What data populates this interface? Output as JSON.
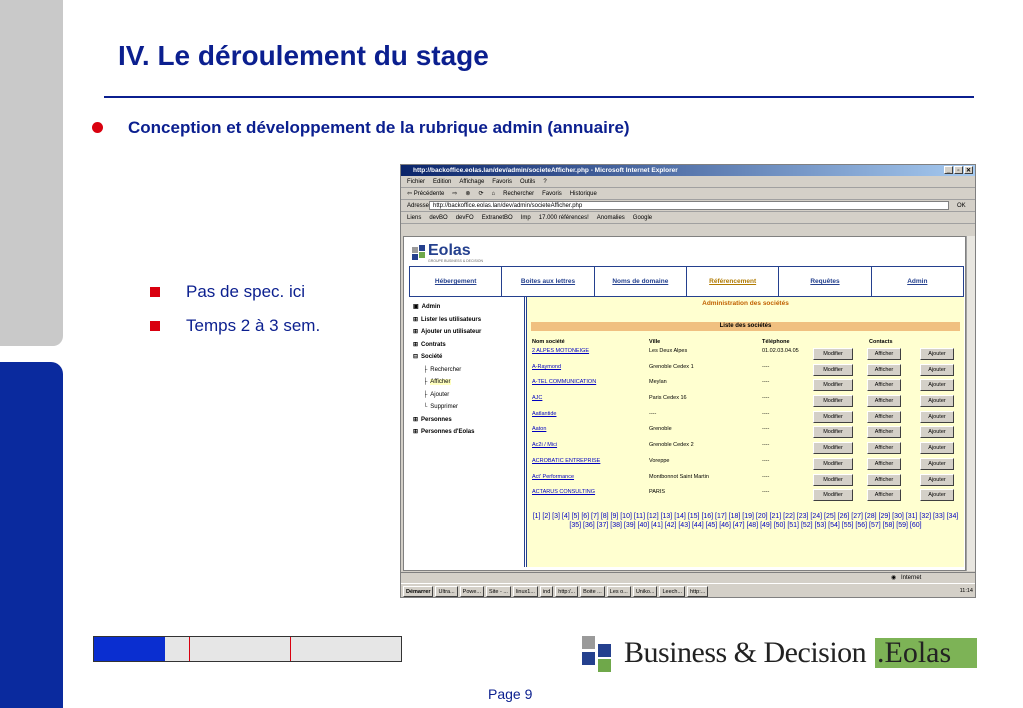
{
  "slide": {
    "title": "IV. Le déroulement du stage",
    "subtitle": "Conception et développement  de la rubrique admin (annuaire)",
    "bullets": [
      "Pas de spec. ici",
      "Temps  2 à 3 sem."
    ],
    "page": "Page 9",
    "footer_logo": {
      "main": "Business & Decision",
      "dot": ".",
      "brand": "Eolas"
    },
    "progress_fraction": 0.23,
    "colors": {
      "title": "#0b1f8f",
      "bullet": "#d9000f",
      "sidebar_top": "#c9c9c9",
      "sidebar_bottom": "#0a2a9e",
      "progress": "#0a2ed0"
    }
  },
  "browser": {
    "title": "http://backoffice.eolas.lan/dev/admin/societeAfficher.php - Microsoft Internet Explorer",
    "window_buttons": [
      "_",
      "▫",
      "✕"
    ],
    "menu": [
      "Fichier",
      "Edition",
      "Affichage",
      "Favoris",
      "Outils",
      "?"
    ],
    "toolbar": [
      "⇦ Précédente",
      "⇨",
      "⊗",
      "⟳",
      "⌂",
      "Rechercher",
      "Favoris",
      "Historique"
    ],
    "address_label": "Adresse",
    "address": "http://backoffice.eolas.lan/dev/admin/societeAfficher.php",
    "go": "OK",
    "links_label": "Liens",
    "links": [
      "devBO",
      "devFO",
      "ExtranetBO",
      "Imp",
      "17.000 références!",
      "Anomalies",
      "Google"
    ],
    "status_zone": "Internet",
    "status_icon": "globe-icon"
  },
  "site": {
    "logo": "Eolas",
    "logo_sub": "GROUPE BUSINESS & DECISION",
    "nav": [
      {
        "label": "Hébergement"
      },
      {
        "label": "Boites aux lettres"
      },
      {
        "label": "Noms de domaine"
      },
      {
        "label": "Référencement",
        "highlight": true
      },
      {
        "label": "Requêtes"
      },
      {
        "label": "Admin"
      }
    ],
    "tree": [
      {
        "label": "Admin",
        "bold": true,
        "prefix": "▣"
      },
      {
        "label": "Lister les utilisateurs",
        "bold": true,
        "prefix": "⊞"
      },
      {
        "label": "Ajouter un utilisateur",
        "bold": true,
        "prefix": "⊞"
      },
      {
        "label": "Contrats",
        "bold": true,
        "prefix": "⊞"
      },
      {
        "label": "Société",
        "bold": true,
        "prefix": "⊟"
      },
      {
        "label": "Rechercher",
        "bold": false,
        "prefix": "├"
      },
      {
        "label": "Afficher",
        "bold": false,
        "prefix": "├"
      },
      {
        "label": "Ajouter",
        "bold": false,
        "prefix": "├"
      },
      {
        "label": "Supprimer",
        "bold": false,
        "prefix": "└"
      },
      {
        "label": "Personnes",
        "bold": true,
        "prefix": "⊞"
      },
      {
        "label": "Personnes d'Eolas",
        "bold": true,
        "prefix": "⊞"
      }
    ],
    "admin_title": "Administration des sociétés",
    "list_title": "Liste des sociétés",
    "columns": [
      "Nom société",
      "Ville",
      "Téléphone",
      "Contacts"
    ],
    "buttons": [
      "Modifier",
      "Afficher",
      "Ajouter"
    ],
    "rows": [
      [
        "2 ALPES MOTONEIGE",
        "Les Deux Alpes",
        "01.02.03.04.05"
      ],
      [
        "A-Raymond",
        "Grenoble Cedex 1",
        "----"
      ],
      [
        "A-TEL COMMUNICATION",
        "Meylan",
        "----"
      ],
      [
        "AJC",
        "Paris Cedex 16",
        "----"
      ],
      [
        "Aatlantide",
        "----",
        "----"
      ],
      [
        "Aaton",
        "Grenoble",
        "----"
      ],
      [
        "Ac2i / Mici",
        "Grenoble Cedex 2",
        "----"
      ],
      [
        "ACROBATIC ENTREPRISE",
        "Voreppe",
        "----"
      ],
      [
        "Act' Performance",
        "Montbonnot Saint Martin",
        "----"
      ],
      [
        "ACTARUS CONSULTING",
        "PARIS",
        "----"
      ]
    ],
    "pager": "[1] [2] [3] [4] [5] [6] [7] [8] [9] [10] [11] [12] [13] [14] [15] [16] [17] [18] [19] [20] [21] [22] [23] [24] [25] [26] [27] [28] [29] [30] [31] [32] [33] [34] [35] [36] [37] [38] [39] [40] [41] [42] [43] [44] [45] [46] [47] [48] [49] [50] [51] [52] [53] [54] [55] [56] [57] [58] [59] [60]"
  },
  "taskbar": {
    "start": "Démarrer",
    "items": [
      "Ultra...",
      "Powe...",
      "Site - ...",
      "linux1...",
      "ind",
      "http:/...",
      "Boite ...",
      "Les o...",
      "Uniko...",
      "Leech...",
      "http:..."
    ],
    "clock": "11:14"
  }
}
